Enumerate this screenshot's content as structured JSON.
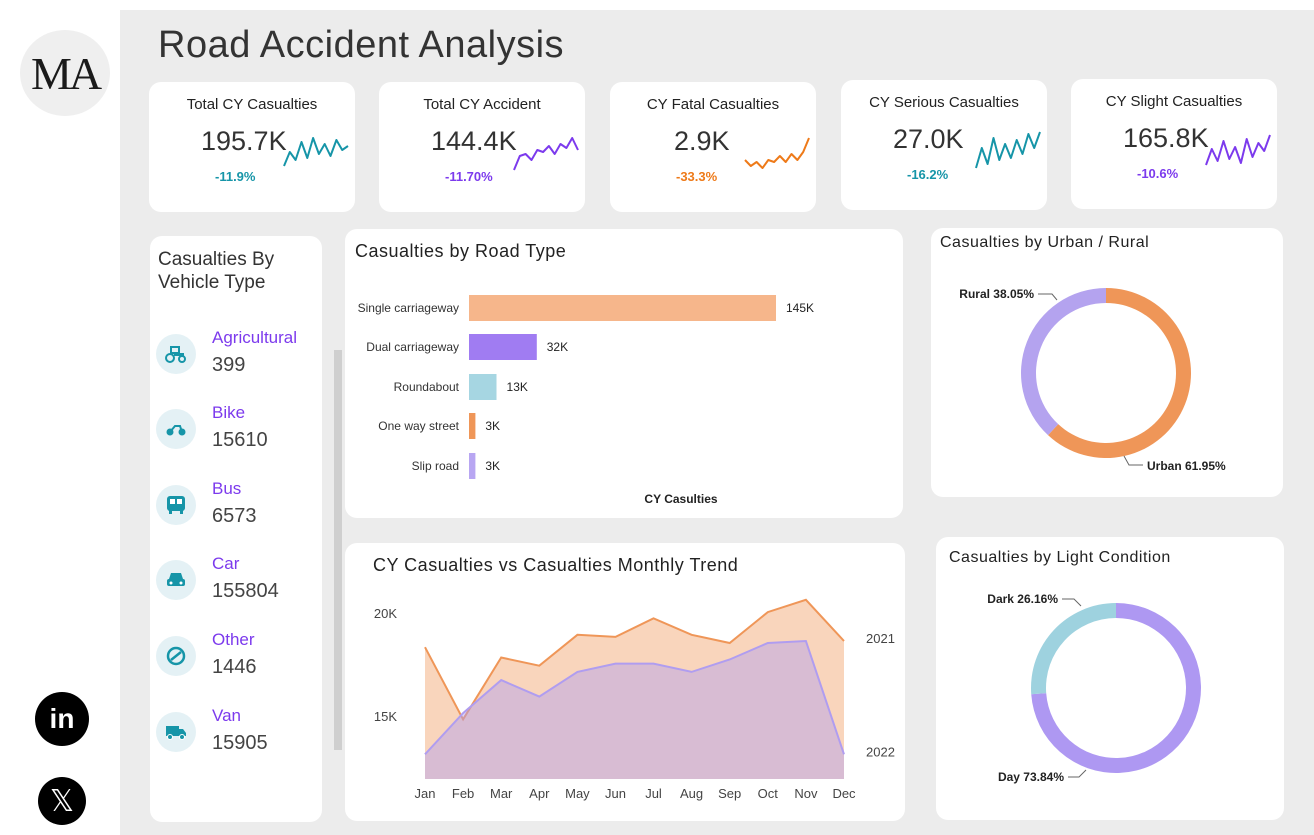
{
  "title": "Road Accident Analysis",
  "logo_text": "MA",
  "colors": {
    "teal": "#1695a8",
    "purple": "#7c3aed",
    "orange": "#ee7a19",
    "peach": "#f6b68b",
    "light_teal": "#9fd3df",
    "lavender": "#b09df0",
    "urban": "#ef9658",
    "rural": "#b4a3ef",
    "dark": "#9ed2df",
    "day": "#ae98f2"
  },
  "kpis": [
    {
      "label": "Total CY Casualties",
      "value": "195.7K",
      "change": "-11.9%",
      "color": "#1695a8",
      "spark": [
        0.2,
        0.55,
        0.35,
        0.8,
        0.4,
        0.9,
        0.5,
        0.75,
        0.45,
        0.85,
        0.6,
        0.7
      ]
    },
    {
      "label": "Total CY Accident",
      "value": "144.4K",
      "change": "-11.70%",
      "color": "#7c3aed",
      "spark": [
        0.1,
        0.45,
        0.5,
        0.35,
        0.6,
        0.55,
        0.7,
        0.5,
        0.75,
        0.65,
        0.9,
        0.6
      ]
    },
    {
      "label": "CY Fatal Casualties",
      "value": "2.9K",
      "change": "-33.3%",
      "color": "#ee7a19",
      "spark": [
        0.35,
        0.2,
        0.3,
        0.15,
        0.35,
        0.3,
        0.45,
        0.3,
        0.5,
        0.35,
        0.55,
        0.9
      ]
    },
    {
      "label": "CY Serious Casualties",
      "value": "27.0K",
      "change": "-16.2%",
      "color": "#1695a8",
      "spark": [
        0.1,
        0.6,
        0.2,
        0.85,
        0.3,
        0.7,
        0.35,
        0.8,
        0.45,
        0.95,
        0.6,
        1.0
      ]
    },
    {
      "label": "CY Slight Casualties",
      "value": "165.8K",
      "change": "-10.6%",
      "color": "#7c3aed",
      "spark": [
        0.15,
        0.55,
        0.25,
        0.75,
        0.3,
        0.6,
        0.2,
        0.8,
        0.35,
        0.7,
        0.5,
        0.9
      ]
    }
  ],
  "vehicle": {
    "title": "Casualties By Vehicle Type",
    "items": [
      {
        "name": "Agricultural",
        "value": "399",
        "icon": "tractor-icon"
      },
      {
        "name": "Bike",
        "value": "15610",
        "icon": "bike-icon"
      },
      {
        "name": "Bus",
        "value": "6573",
        "icon": "bus-icon"
      },
      {
        "name": "Car",
        "value": "155804",
        "icon": "car-icon"
      },
      {
        "name": "Other",
        "value": "1446",
        "icon": "other-icon"
      },
      {
        "name": "Van",
        "value": "15905",
        "icon": "van-icon"
      }
    ]
  },
  "road_title": "Casualties by Road Type",
  "trend_title": "CY Casualties vs Casualties Monthly Trend",
  "urban_title": "Casualties by Urban / Rural",
  "light_title": "Casualties by Light Condition",
  "social": {
    "linkedin": "in",
    "x": "𝕏"
  },
  "chart_data": [
    {
      "type": "bar",
      "title": "Casualties by Road Type",
      "xlabel": "CY Casulties",
      "categories": [
        "Single carriageway",
        "Dual carriageway",
        "Roundabout",
        "One way street",
        "Slip road"
      ],
      "values": [
        145,
        32,
        13,
        3,
        3
      ],
      "labels": [
        "145K",
        "32K",
        "13K",
        "3K",
        "3K"
      ],
      "colors": [
        "#f6b68b",
        "#a07cf2",
        "#a6d6e2",
        "#ef9658",
        "#b8a6f2"
      ]
    },
    {
      "type": "area",
      "title": "CY Casualties vs Casualties Monthly Trend",
      "categories": [
        "Jan",
        "Feb",
        "Mar",
        "Apr",
        "May",
        "Jun",
        "Jul",
        "Aug",
        "Sep",
        "Oct",
        "Nov",
        "Dec"
      ],
      "ylim": [
        12000,
        22000
      ],
      "yticks": [
        15000,
        20000
      ],
      "ytick_labels": [
        "15K",
        "20K"
      ],
      "series": [
        {
          "name": "2021",
          "color": "#ef9658",
          "values": [
            18400,
            14900,
            17900,
            17500,
            19000,
            18900,
            19800,
            19000,
            18600,
            20100,
            20700,
            18700
          ]
        },
        {
          "name": "2022",
          "color": "#b09df0",
          "values": [
            13200,
            15200,
            16800,
            16000,
            17200,
            17600,
            17600,
            17200,
            17800,
            18600,
            18700,
            13200
          ]
        }
      ]
    },
    {
      "type": "pie",
      "title": "Casualties by Urban / Rural",
      "categories": [
        "Urban",
        "Rural"
      ],
      "values": [
        61.95,
        38.05
      ],
      "labels": [
        "Urban 61.95%",
        "Rural 38.05%"
      ],
      "colors": [
        "#ef9658",
        "#b4a3ef"
      ]
    },
    {
      "type": "pie",
      "title": "Casualties by Light Condition",
      "categories": [
        "Day",
        "Dark"
      ],
      "values": [
        73.84,
        26.16
      ],
      "labels": [
        "Day 73.84%",
        "Dark 26.16%"
      ],
      "colors": [
        "#ae98f2",
        "#9ed2df"
      ]
    }
  ]
}
